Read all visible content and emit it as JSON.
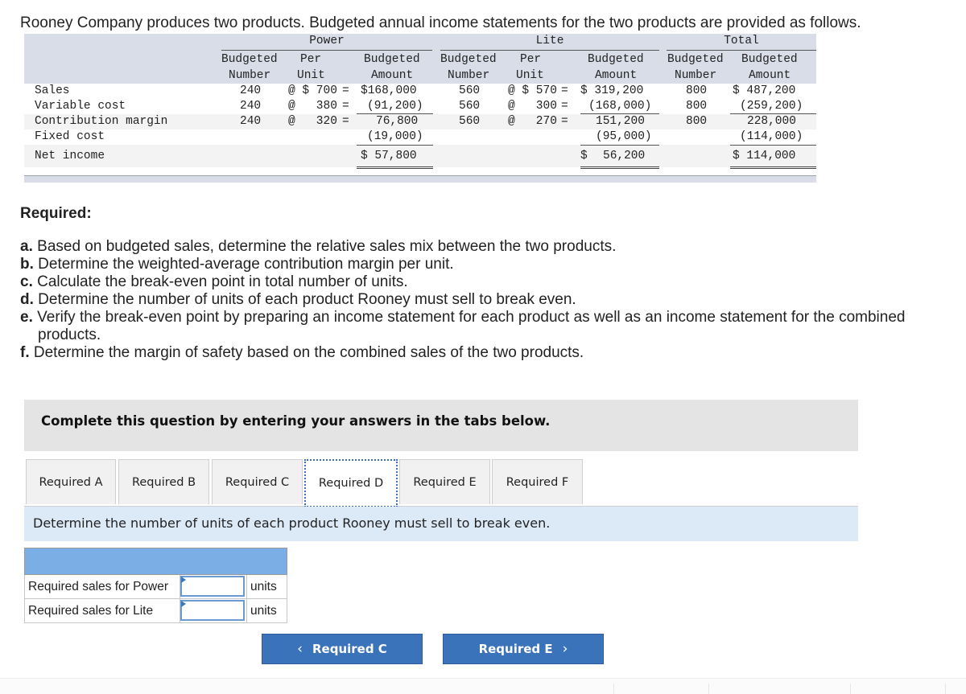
{
  "intro": "Rooney Company produces two products. Budgeted annual income statements for the two products are provided as follows.",
  "statement": {
    "groups": {
      "power": "Power",
      "lite": "Lite",
      "total": "Total"
    },
    "headers": {
      "budgeted": "Budgeted",
      "number": "Number",
      "per": "Per",
      "unit": "Unit",
      "amount": "Amount"
    },
    "rows": [
      {
        "label": "Sales",
        "power_num": "240",
        "power_at": "@ $ 700",
        "power_eq": "=",
        "power_amt": "$168,000",
        "lite_num": "560",
        "lite_at": "@ $ 570",
        "lite_eq": "=",
        "lite_amt": "$ 319,200",
        "total_num": "800",
        "total_amt": "$ 487,200"
      },
      {
        "label": "Variable cost",
        "power_num": "240",
        "power_at": "@   380",
        "power_eq": "=",
        "power_amt": "(91,200)",
        "lite_num": "560",
        "lite_at": "@   300",
        "lite_eq": "=",
        "lite_amt": "(168,000)",
        "total_num": "800",
        "total_amt": "(259,200)"
      },
      {
        "label": "Contribution margin",
        "power_num": "240",
        "power_at": "@   320",
        "power_eq": "=",
        "power_amt": "76,800",
        "lite_num": "560",
        "lite_at": "@   270",
        "lite_eq": "=",
        "lite_amt": "151,200",
        "total_num": "800",
        "total_amt": "228,000"
      },
      {
        "label": "Fixed cost",
        "power_amt": "(19,000)",
        "lite_amt": "(95,000)",
        "total_amt": "(114,000)"
      },
      {
        "label": "Net income",
        "power_amt": "$ 57,800",
        "lite_dollar": "$",
        "lite_amt": "56,200",
        "total_amt": "$ 114,000"
      }
    ]
  },
  "required": {
    "heading": "Required:",
    "items": [
      {
        "letter": "a.",
        "text": "Based on budgeted sales, determine the relative sales mix between the two products."
      },
      {
        "letter": "b.",
        "text": "Determine the weighted-average contribution margin per unit."
      },
      {
        "letter": "c.",
        "text": "Calculate the break-even point in total number of units."
      },
      {
        "letter": "d.",
        "text": "Determine the number of units of each product Rooney must sell to break even."
      },
      {
        "letter": "e.",
        "text": "Verify the break-even point by preparing an income statement for each product as well as an income statement for the combined",
        "cont": "products."
      },
      {
        "letter": "f.",
        "text": "Determine the margin of safety based on the combined sales of the two products."
      }
    ]
  },
  "instruction": "Complete this question by entering your answers in the tabs below.",
  "tabs": [
    {
      "label": "Required A",
      "active": false
    },
    {
      "label": "Required B",
      "active": false
    },
    {
      "label": "Required C",
      "active": false
    },
    {
      "label": "Required D",
      "active": true
    },
    {
      "label": "Required E",
      "active": false
    },
    {
      "label": "Required F",
      "active": false
    }
  ],
  "prompt": "Determine the number of units of each product Rooney must sell to break even.",
  "answer_table": {
    "rows": [
      {
        "label": "Required sales for Power",
        "value": "",
        "unit": "units"
      },
      {
        "label": "Required sales for Lite",
        "value": "",
        "unit": "units"
      }
    ]
  },
  "nav": {
    "prev_label": "Required C",
    "next_label": "Required E",
    "prev_icon": "‹",
    "next_icon": "›"
  },
  "colors": {
    "accent": "#3b73bb",
    "table_header": "#d9dde8",
    "answer_header": "#7aaee4",
    "prompt_bg": "#dceaf8",
    "instruction_bg": "#e4e4e4"
  }
}
